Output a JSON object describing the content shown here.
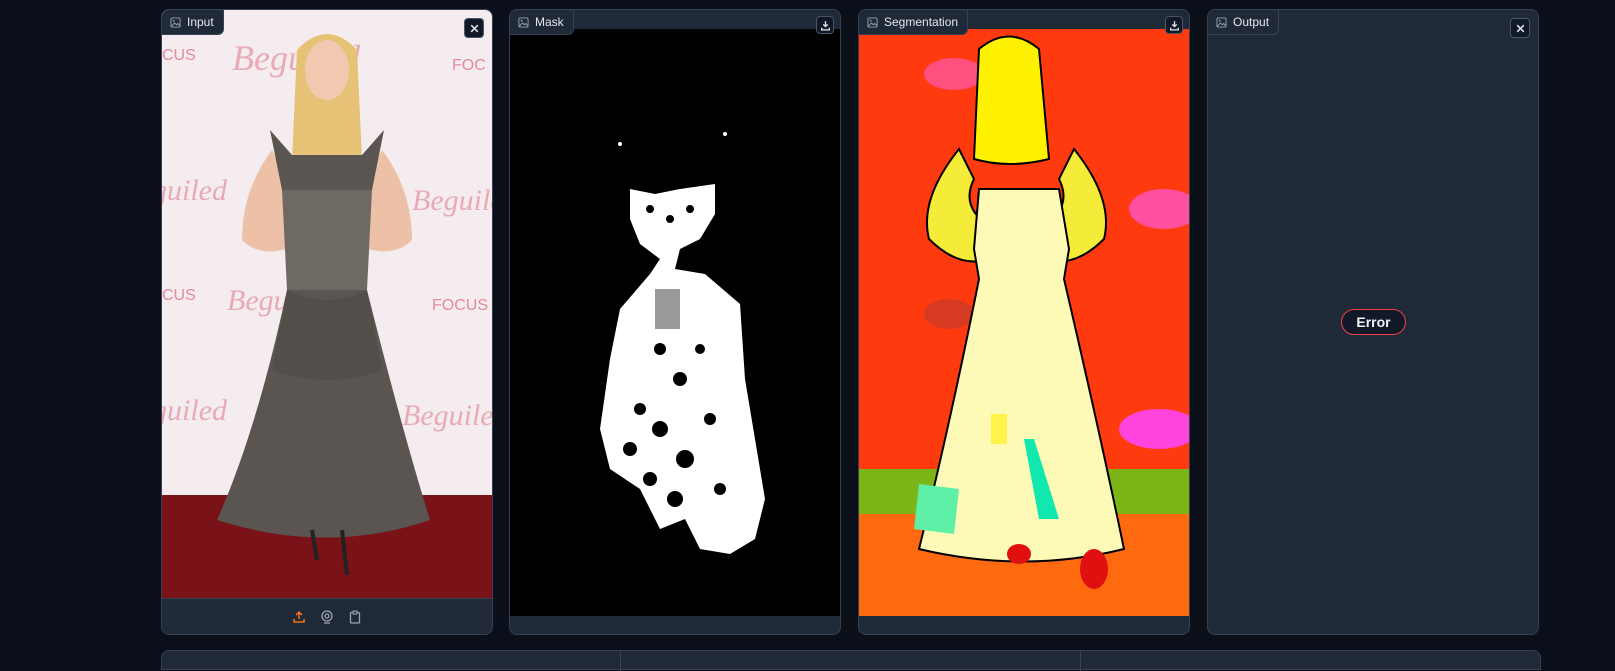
{
  "panels": {
    "input": {
      "label": "Input"
    },
    "mask": {
      "label": "Mask"
    },
    "segmentation": {
      "label": "Segmentation"
    },
    "output": {
      "label": "Output",
      "status": "Error"
    }
  },
  "colors": {
    "background": "#0b0f19",
    "panel": "#1f2937",
    "border": "#374151",
    "accent": "#f97316",
    "error": "#ef4444"
  },
  "icons": {
    "label": "image-icon",
    "close": "close-icon",
    "download": "download-icon",
    "upload": "upload-icon",
    "webcam": "webcam-icon",
    "clipboard": "clipboard-icon"
  }
}
